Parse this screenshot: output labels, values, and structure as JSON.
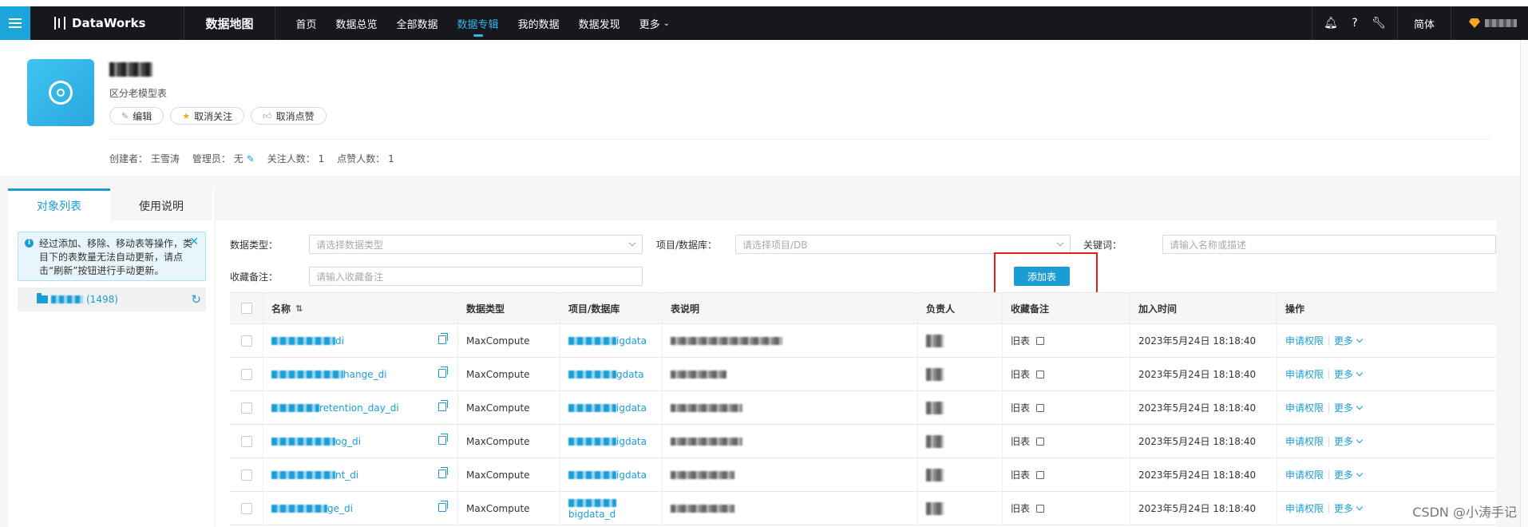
{
  "topbar": {
    "logo": "DataWorks",
    "section": "数据地图",
    "nav": [
      "首页",
      "数据总览",
      "全部数据",
      "数据专辑",
      "我的数据",
      "数据发现",
      "更多"
    ],
    "active_nav": "数据专辑",
    "lang": "简体"
  },
  "header": {
    "subtitle": "区分老模型表",
    "buttons": {
      "edit": "编辑",
      "unfollow": "取消关注",
      "unlike": "取消点赞"
    },
    "meta": {
      "creator_label": "创建者：",
      "creator": "王雪涛",
      "admin_label": "管理员：",
      "admin": "无",
      "followers_label": "关注人数：",
      "followers": "1",
      "likes_label": "点赞人数：",
      "likes": "1"
    }
  },
  "tabs": [
    "对象列表",
    "使用说明"
  ],
  "tip": "经过添加、移除、移动表等操作，类目下的表数量无法自动更新，请点击“刷新”按钮进行手动更新。",
  "folder": {
    "count": "(1498)"
  },
  "filters": {
    "type_label": "数据类型：",
    "type_placeholder": "请选择数据类型",
    "project_label": "项目/数据库：",
    "project_placeholder": "请选择项目/DB",
    "keyword_label": "关键词：",
    "keyword_placeholder": "请输入名称或描述",
    "note_label": "收藏备注：",
    "note_placeholder": "请输入收藏备注",
    "add_button": "添加表"
  },
  "table": {
    "columns": [
      "名称",
      "数据类型",
      "项目/数据库",
      "表说明",
      "负责人",
      "收藏备注",
      "加入时间",
      "操作"
    ],
    "rows": [
      {
        "name_tail": "di",
        "type": "MaxCompute",
        "project_tail": "igdata",
        "note": "旧表",
        "time": "2023年5月24日 18:18:40"
      },
      {
        "name_tail": "hange_di",
        "type": "MaxCompute",
        "project_tail": "gdata",
        "note": "旧表",
        "time": "2023年5月24日 18:18:40"
      },
      {
        "name_tail": "retention_day_di",
        "type": "MaxCompute",
        "project_tail": "igdata",
        "note": "旧表",
        "time": "2023年5月24日 18:18:40"
      },
      {
        "name_tail": "og_di",
        "type": "MaxCompute",
        "project_tail": "igdata",
        "note": "旧表",
        "time": "2023年5月24日 18:18:40"
      },
      {
        "name_tail": "nt_di",
        "type": "MaxCompute",
        "project_tail": "igdata",
        "note": "旧表",
        "time": "2023年5月24日 18:18:40"
      },
      {
        "name_tail": "ge_di",
        "type": "MaxCompute",
        "project_tail": "bigdata_d",
        "note": "旧表",
        "time": "2023年5月24日 18:18:40"
      }
    ],
    "op_apply": "申请权限",
    "op_more": "更多"
  },
  "watermark": "CSDN @小涛手记",
  "colors": {
    "accent": "#1b9dd4",
    "nav_bg": "#16181d",
    "highlight": "#e02020"
  }
}
